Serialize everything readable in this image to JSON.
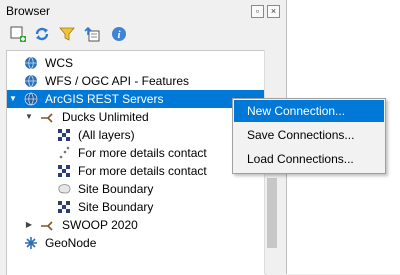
{
  "panel": {
    "title": "Browser",
    "float_icon": "float-icon",
    "close_icon": "close-icon"
  },
  "toolbar": {
    "buttons": [
      {
        "name": "add-layer-icon"
      },
      {
        "name": "refresh-icon"
      },
      {
        "name": "filter-icon"
      },
      {
        "name": "collapse-all-icon"
      },
      {
        "name": "info-icon"
      }
    ]
  },
  "tree": {
    "rows": [
      {
        "label": "WCS",
        "icon": "globe-icon"
      },
      {
        "label": "WFS / OGC API - Features",
        "icon": "globe-icon"
      },
      {
        "label": "ArcGIS REST Servers",
        "icon": "globe-icon",
        "expanded": true,
        "selected": true
      },
      {
        "label": "Ducks Unlimited",
        "icon": "server-connection-icon",
        "expanded": true
      },
      {
        "label": "(All layers)",
        "icon": "raster-layer-icon"
      },
      {
        "label": "For more details contact",
        "icon": "point-layer-icon"
      },
      {
        "label": "For more details contact",
        "icon": "raster-layer-icon"
      },
      {
        "label": "Site Boundary",
        "icon": "polygon-layer-icon"
      },
      {
        "label": "Site Boundary",
        "icon": "raster-layer-icon"
      },
      {
        "label": "SWOOP 2020",
        "icon": "server-connection-icon",
        "expanded": false
      },
      {
        "label": "GeoNode",
        "icon": "geonode-icon"
      }
    ]
  },
  "context_menu": {
    "items": [
      {
        "label": "New Connection...",
        "highlighted": true
      },
      {
        "label": "Save Connections..."
      },
      {
        "label": "Load Connections..."
      }
    ]
  },
  "colors": {
    "selection": "#0078d7",
    "panel_bg": "#f0f0f0",
    "menu_bg": "#f2f2f2"
  }
}
